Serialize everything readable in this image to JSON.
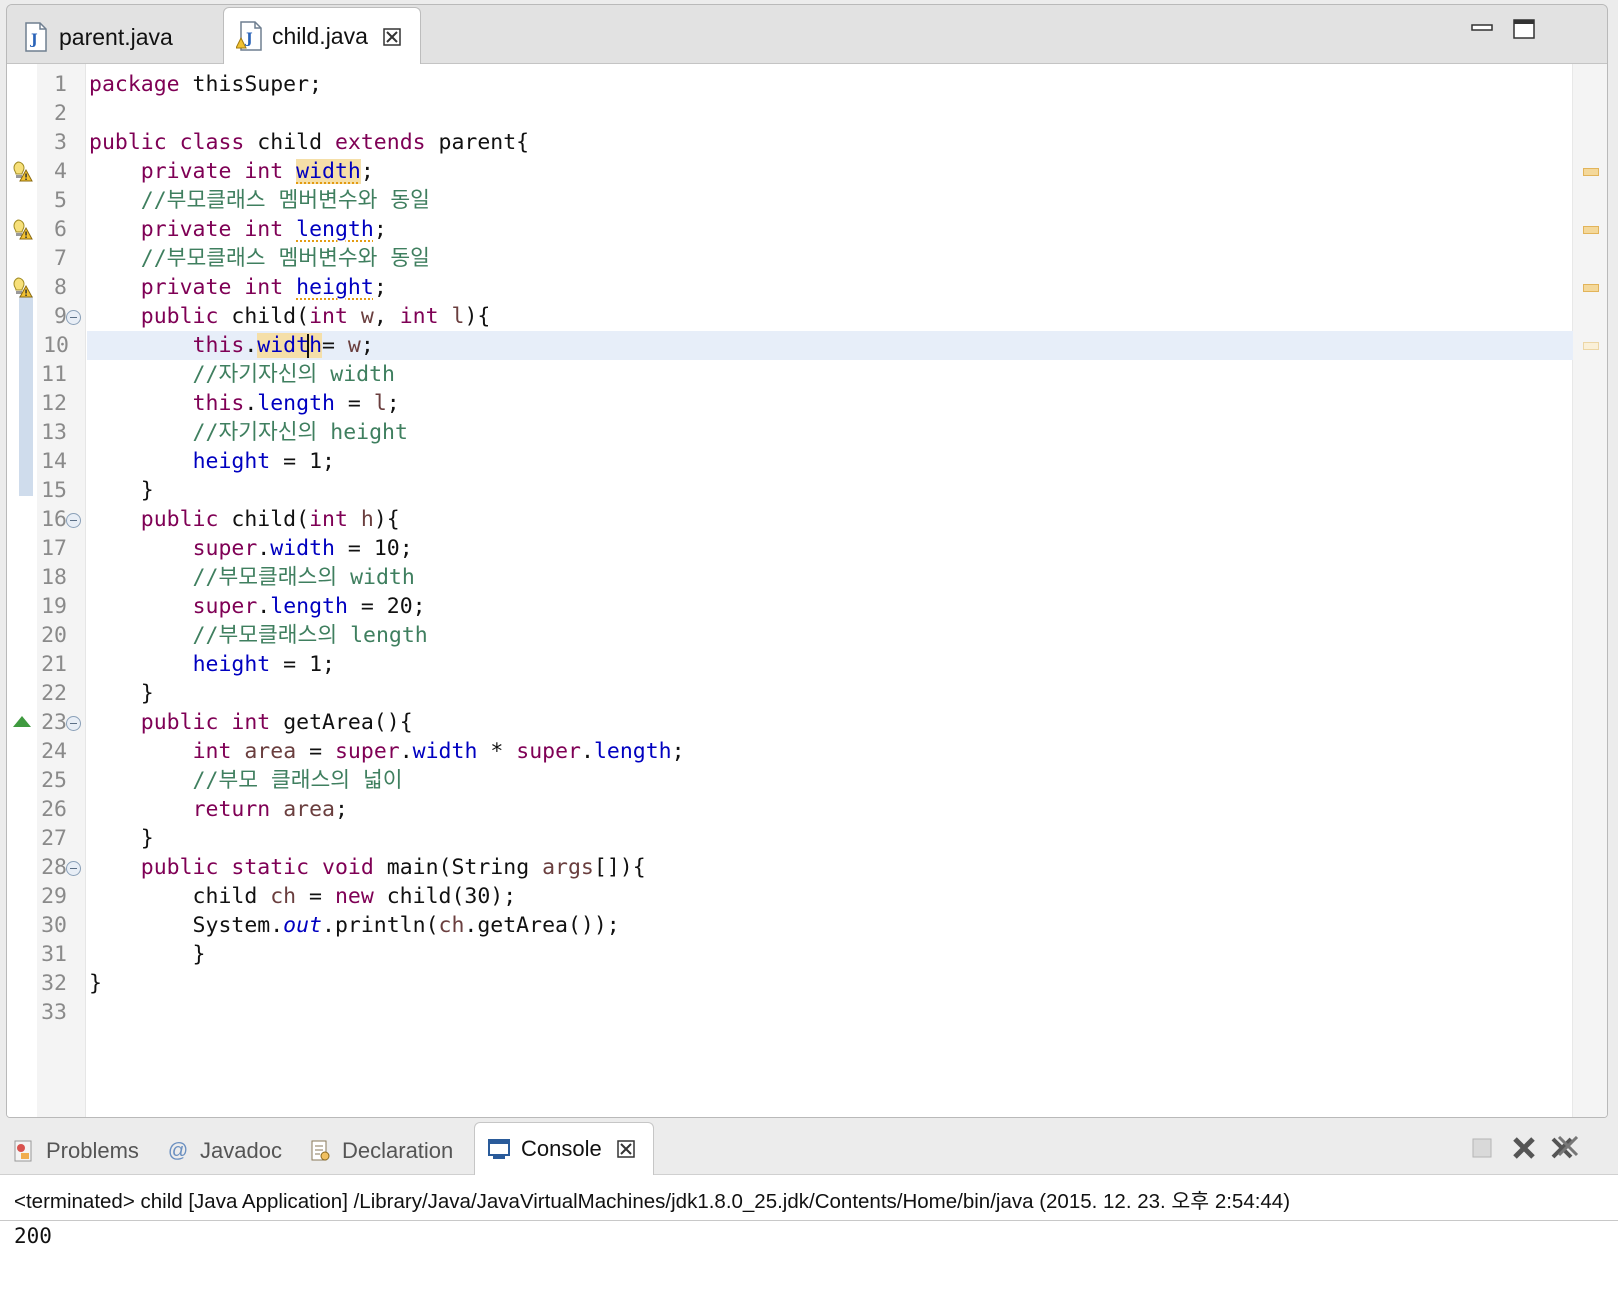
{
  "editor": {
    "tabs": [
      {
        "label": "parent.java",
        "active": false,
        "icon": "java-file-icon"
      },
      {
        "label": "child.java",
        "active": true,
        "icon": "java-file-warning-icon"
      }
    ],
    "window_controls": [
      "minimize-icon",
      "maximize-icon"
    ],
    "current_line": 10,
    "warning_lines": [
      4,
      6,
      8
    ],
    "override_marker_line": 23,
    "fold_lines": [
      9,
      16,
      23,
      28
    ],
    "lines": [
      {
        "n": "1",
        "tokens": [
          [
            "kw",
            "package"
          ],
          [
            "",
            " thisSuper;"
          ]
        ]
      },
      {
        "n": "2",
        "tokens": []
      },
      {
        "n": "3",
        "tokens": [
          [
            "kw",
            "public"
          ],
          [
            "",
            " "
          ],
          [
            "kw",
            "class"
          ],
          [
            "",
            " child "
          ],
          [
            "kw",
            "extends"
          ],
          [
            "",
            " parent{"
          ]
        ]
      },
      {
        "n": "4",
        "tokens": [
          [
            "",
            "    "
          ],
          [
            "kw",
            "private"
          ],
          [
            "",
            " "
          ],
          [
            "kw",
            "int"
          ],
          [
            "",
            " "
          ],
          [
            "fld hl warn-u",
            "width"
          ],
          [
            "",
            ";"
          ]
        ]
      },
      {
        "n": "5",
        "tokens": [
          [
            "cm",
            "    //부모클래스 멤버변수와 동일"
          ]
        ]
      },
      {
        "n": "6",
        "tokens": [
          [
            "",
            "    "
          ],
          [
            "kw",
            "private"
          ],
          [
            "",
            " "
          ],
          [
            "kw",
            "int"
          ],
          [
            "",
            " "
          ],
          [
            "fld warn-u",
            "length"
          ],
          [
            "",
            ";"
          ]
        ]
      },
      {
        "n": "7",
        "tokens": [
          [
            "cm",
            "    //부모클래스 멤버변수와 동일"
          ]
        ]
      },
      {
        "n": "8",
        "tokens": [
          [
            "",
            "    "
          ],
          [
            "kw",
            "private"
          ],
          [
            "",
            " "
          ],
          [
            "kw",
            "int"
          ],
          [
            "",
            " "
          ],
          [
            "fld warn-u",
            "height"
          ],
          [
            "",
            ";"
          ]
        ]
      },
      {
        "n": "9",
        "tokens": [
          [
            "",
            "    "
          ],
          [
            "kw",
            "public"
          ],
          [
            "",
            " child("
          ],
          [
            "kw",
            "int"
          ],
          [
            "",
            " "
          ],
          [
            "loc",
            "w"
          ],
          [
            "",
            ", "
          ],
          [
            "kw",
            "int"
          ],
          [
            "",
            " "
          ],
          [
            "loc",
            "l"
          ],
          [
            "",
            "){"
          ]
        ]
      },
      {
        "n": "10",
        "tokens": [
          [
            "",
            "        "
          ],
          [
            "kw",
            "this"
          ],
          [
            "",
            "."
          ],
          [
            "fld hl",
            "width"
          ],
          [
            "",
            "= "
          ],
          [
            "loc",
            "w"
          ],
          [
            "",
            ";"
          ]
        ]
      },
      {
        "n": "11",
        "tokens": [
          [
            "cm",
            "        //자기자신의 width"
          ]
        ]
      },
      {
        "n": "12",
        "tokens": [
          [
            "",
            "        "
          ],
          [
            "kw",
            "this"
          ],
          [
            "",
            "."
          ],
          [
            "fld",
            "length"
          ],
          [
            "",
            " = "
          ],
          [
            "loc",
            "l"
          ],
          [
            "",
            ";"
          ]
        ]
      },
      {
        "n": "13",
        "tokens": [
          [
            "cm",
            "        //자기자신의 height"
          ]
        ]
      },
      {
        "n": "14",
        "tokens": [
          [
            "",
            "        "
          ],
          [
            "fld",
            "height"
          ],
          [
            "",
            " = 1;"
          ]
        ]
      },
      {
        "n": "15",
        "tokens": [
          [
            "",
            "    }"
          ]
        ]
      },
      {
        "n": "16",
        "tokens": [
          [
            "",
            "    "
          ],
          [
            "kw",
            "public"
          ],
          [
            "",
            " child("
          ],
          [
            "kw",
            "int"
          ],
          [
            "",
            " "
          ],
          [
            "loc",
            "h"
          ],
          [
            "",
            "){"
          ]
        ]
      },
      {
        "n": "17",
        "tokens": [
          [
            "",
            "        "
          ],
          [
            "kw",
            "super"
          ],
          [
            "",
            "."
          ],
          [
            "fld",
            "width"
          ],
          [
            "",
            " = 10;"
          ]
        ]
      },
      {
        "n": "18",
        "tokens": [
          [
            "cm",
            "        //부모클래스의 width"
          ]
        ]
      },
      {
        "n": "19",
        "tokens": [
          [
            "",
            "        "
          ],
          [
            "kw",
            "super"
          ],
          [
            "",
            "."
          ],
          [
            "fld",
            "length"
          ],
          [
            "",
            " = 20;"
          ]
        ]
      },
      {
        "n": "20",
        "tokens": [
          [
            "cm",
            "        //부모클래스의 length"
          ]
        ]
      },
      {
        "n": "21",
        "tokens": [
          [
            "",
            "        "
          ],
          [
            "fld",
            "height"
          ],
          [
            "",
            " = 1;"
          ]
        ]
      },
      {
        "n": "22",
        "tokens": [
          [
            "",
            "    }"
          ]
        ]
      },
      {
        "n": "23",
        "tokens": [
          [
            "",
            "    "
          ],
          [
            "kw",
            "public"
          ],
          [
            "",
            " "
          ],
          [
            "kw",
            "int"
          ],
          [
            "",
            " getArea(){"
          ]
        ]
      },
      {
        "n": "24",
        "tokens": [
          [
            "",
            "        "
          ],
          [
            "kw",
            "int"
          ],
          [
            "",
            " "
          ],
          [
            "loc",
            "area"
          ],
          [
            "",
            " = "
          ],
          [
            "kw",
            "super"
          ],
          [
            "",
            "."
          ],
          [
            "fld",
            "width"
          ],
          [
            "",
            " * "
          ],
          [
            "kw",
            "super"
          ],
          [
            "",
            "."
          ],
          [
            "fld",
            "length"
          ],
          [
            "",
            ";"
          ]
        ]
      },
      {
        "n": "25",
        "tokens": [
          [
            "cm",
            "        //부모 클래스의 넓이"
          ]
        ]
      },
      {
        "n": "26",
        "tokens": [
          [
            "",
            "        "
          ],
          [
            "kw",
            "return"
          ],
          [
            "",
            " "
          ],
          [
            "loc",
            "area"
          ],
          [
            "",
            ";"
          ]
        ]
      },
      {
        "n": "27",
        "tokens": [
          [
            "",
            "    }"
          ]
        ]
      },
      {
        "n": "28",
        "tokens": [
          [
            "",
            "    "
          ],
          [
            "kw",
            "public"
          ],
          [
            "",
            " "
          ],
          [
            "kw",
            "static"
          ],
          [
            "",
            " "
          ],
          [
            "kw",
            "void"
          ],
          [
            "",
            " main(String "
          ],
          [
            "loc",
            "args"
          ],
          [
            "",
            "[]){"
          ]
        ]
      },
      {
        "n": "29",
        "tokens": [
          [
            "",
            "        child "
          ],
          [
            "loc",
            "ch"
          ],
          [
            "",
            " = "
          ],
          [
            "kw",
            "new"
          ],
          [
            "",
            " child(30);"
          ]
        ]
      },
      {
        "n": "30",
        "tokens": [
          [
            "",
            "        System."
          ],
          [
            "stat",
            "out"
          ],
          [
            "",
            ".println("
          ],
          [
            "loc",
            "ch"
          ],
          [
            "",
            ".getArea());"
          ]
        ]
      },
      {
        "n": "31",
        "tokens": [
          [
            "",
            "        }"
          ]
        ]
      },
      {
        "n": "32",
        "tokens": [
          [
            "",
            "}"
          ]
        ]
      },
      {
        "n": "33",
        "tokens": []
      }
    ]
  },
  "bottom_panel": {
    "tabs": [
      {
        "label": "Problems",
        "icon": "problems-icon",
        "active": false
      },
      {
        "label": "Javadoc",
        "icon": "javadoc-icon",
        "active": false
      },
      {
        "label": "Declaration",
        "icon": "declaration-icon",
        "active": false
      },
      {
        "label": "Console",
        "icon": "console-icon",
        "active": true
      }
    ],
    "console_header": "<terminated> child [Java Application] /Library/Java/JavaVirtualMachines/jdk1.8.0_25.jdk/Contents/Home/bin/java (2015. 12. 23. 오후 2:54:44)",
    "console_output": "200"
  },
  "colors": {
    "keyword": "#7f0055",
    "field": "#0000c0",
    "comment": "#3f7f5f",
    "local_var": "#6a3e3e",
    "current_line_bg": "#e7eef9",
    "warning": "#e39b12"
  }
}
